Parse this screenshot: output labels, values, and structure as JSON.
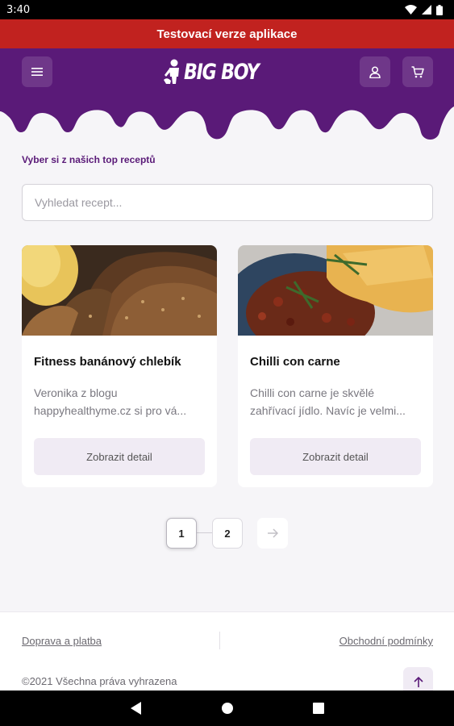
{
  "status_bar": {
    "time": "3:40"
  },
  "banner": {
    "text": "Testovací verze aplikace"
  },
  "header": {
    "brand": "BIG BOY"
  },
  "section": {
    "title": "Vyber si z našich top receptů"
  },
  "search": {
    "placeholder": "Vyhledat recept..."
  },
  "recipes": [
    {
      "title": "Fitness banánový chlebík",
      "desc_line1": "Veronika z blogu",
      "desc_line2": "happyhealthyme.cz si pro vá...",
      "button": "Zobrazit detail"
    },
    {
      "title": "Chilli con carne",
      "desc_line1": "Chilli con carne je skvělé",
      "desc_line2": "zahřívací jídlo. Navíc je velmi...",
      "button": "Zobrazit detail"
    }
  ],
  "pagination": {
    "pages": [
      "1",
      "2"
    ],
    "current": "1"
  },
  "footer": {
    "link_left": "Doprava a platba",
    "link_right": "Obchodní podmínky",
    "copyright": "©2021 Všechna práva vyhrazena"
  },
  "colors": {
    "brand_purple": "#5a1a78",
    "banner_red": "#c1221f"
  }
}
